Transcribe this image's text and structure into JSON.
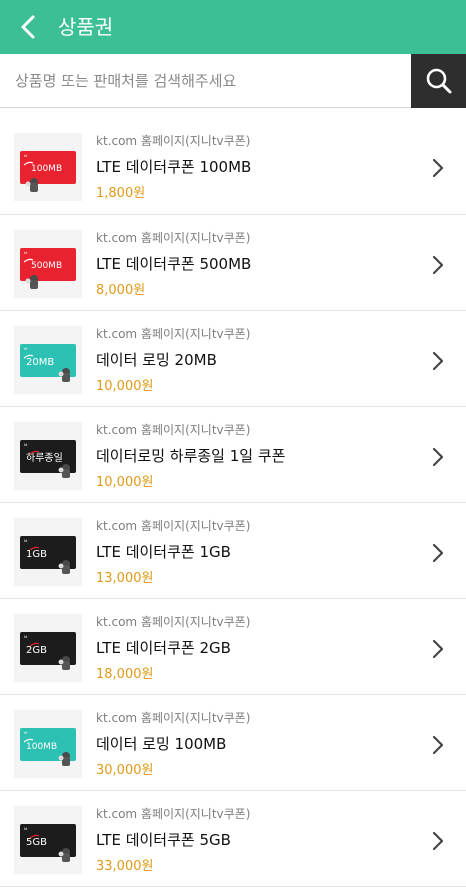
{
  "header": {
    "title": "상품권"
  },
  "search": {
    "placeholder": "상품명 또는 판매처를 검색해주세요"
  },
  "items": [
    {
      "seller": "kt.com 홈페이지(지니tv쿠폰)",
      "name": "LTE 데이터쿠폰 100MB",
      "price": "1,800원",
      "card_label": "100MB",
      "card_color": "#e8232f"
    },
    {
      "seller": "kt.com 홈페이지(지니tv쿠폰)",
      "name": "LTE 데이터쿠폰 500MB",
      "price": "8,000원",
      "card_label": "500MB",
      "card_color": "#e8232f"
    },
    {
      "seller": "kt.com 홈페이지(지니tv쿠폰)",
      "name": "데이터 로밍 20MB",
      "price": "10,000원",
      "card_label": "20MB",
      "card_color": "#2cc1b3"
    },
    {
      "seller": "kt.com 홈페이지(지니tv쿠폰)",
      "name": "데이터로밍 하루종일 1일 쿠폰",
      "price": "10,000원",
      "card_label": "하루종일",
      "card_color": "#1c1c1c"
    },
    {
      "seller": "kt.com 홈페이지(지니tv쿠폰)",
      "name": "LTE 데이터쿠폰 1GB",
      "price": "13,000원",
      "card_label": "1GB",
      "card_color": "#1c1c1c"
    },
    {
      "seller": "kt.com 홈페이지(지니tv쿠폰)",
      "name": "LTE 데이터쿠폰 2GB",
      "price": "18,000원",
      "card_label": "2GB",
      "card_color": "#1c1c1c"
    },
    {
      "seller": "kt.com 홈페이지(지니tv쿠폰)",
      "name": "데이터 로밍 100MB",
      "price": "30,000원",
      "card_label": "100MB",
      "card_color": "#2cc1b3"
    },
    {
      "seller": "kt.com 홈페이지(지니tv쿠폰)",
      "name": "LTE 데이터쿠폰 5GB",
      "price": "33,000원",
      "card_label": "5GB",
      "card_color": "#1c1c1c"
    }
  ],
  "colors": {
    "header_bg": "#3dbf96",
    "price": "#e09a1a",
    "search_button": "#2e2e2e"
  },
  "icons": {
    "back": "chevron-left-icon",
    "search": "search-icon",
    "item_arrow": "chevron-right-icon"
  }
}
